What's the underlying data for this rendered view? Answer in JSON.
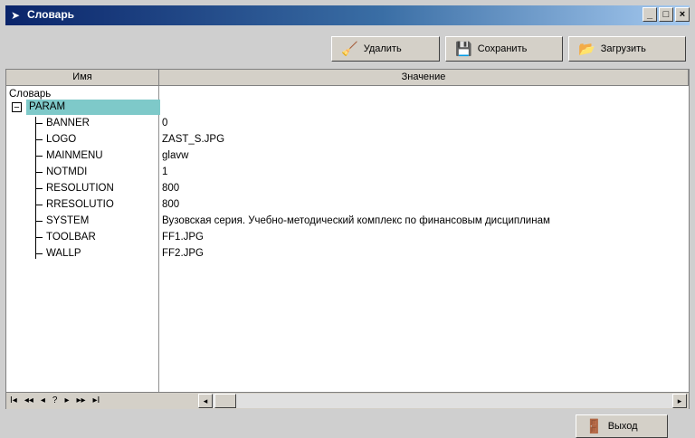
{
  "window": {
    "title": "Словарь"
  },
  "toolbar": {
    "delete_label": "Удалить",
    "save_label": "Сохранить",
    "load_label": "Загрузить"
  },
  "grid": {
    "col_name": "Имя",
    "col_value": "Значение",
    "root": "Словарь",
    "group": "PARAM",
    "rows": [
      {
        "name": "BANNER",
        "value": "0"
      },
      {
        "name": "LOGO",
        "value": "ZAST_S.JPG"
      },
      {
        "name": "MAINMENU",
        "value": "glavw"
      },
      {
        "name": "NOTMDI",
        "value": "1"
      },
      {
        "name": "RESOLUTION",
        "value": "800"
      },
      {
        "name": "RRESOLUTIO",
        "value": "800"
      },
      {
        "name": "SYSTEM",
        "value": "Вузовская серия. Учебно-методический комплекс по финансовым дисциплинам"
      },
      {
        "name": "TOOLBAR",
        "value": "FF1.JPG"
      },
      {
        "name": "WALLP",
        "value": "FF2.JPG"
      }
    ]
  },
  "navigator": {
    "buttons": [
      "I◂",
      "◂◂",
      "◂",
      "?",
      "▸",
      "▸▸",
      "▸I"
    ]
  },
  "footer": {
    "exit_label": "Выход"
  }
}
